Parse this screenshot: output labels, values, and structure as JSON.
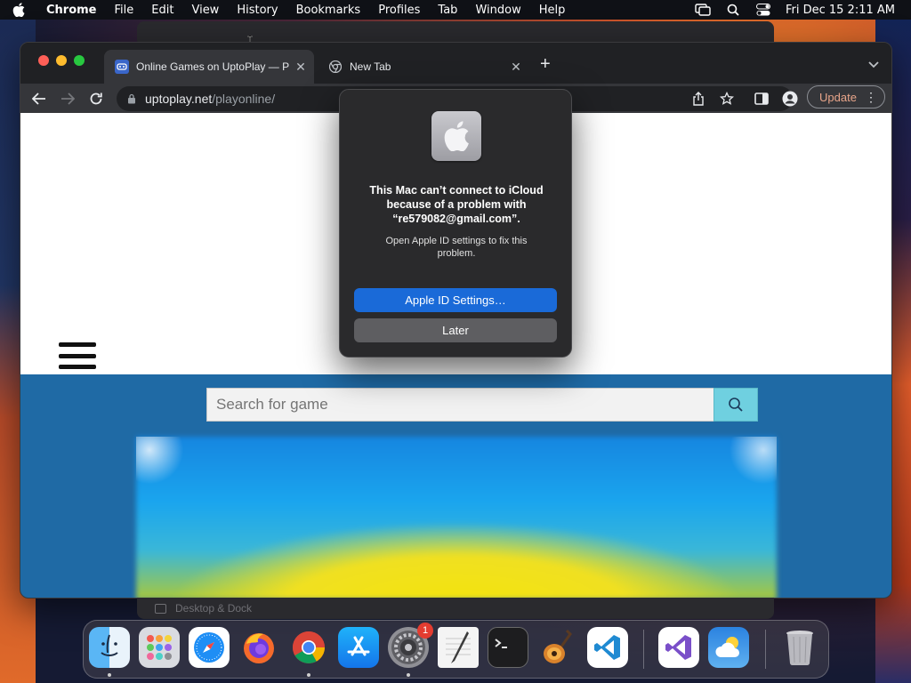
{
  "menubar": {
    "app_name": "Chrome",
    "items": [
      "File",
      "Edit",
      "View",
      "History",
      "Bookmarks",
      "Profiles",
      "Tab",
      "Window",
      "Help"
    ],
    "clock": "Fri Dec 15  2:11 AM"
  },
  "browser": {
    "tabs": [
      {
        "title": "Online Games on UptoPlay — P",
        "active": true
      },
      {
        "title": "New Tab",
        "active": false
      }
    ],
    "url_host": "uptoplay.net",
    "url_path": "/playonline/",
    "update_label": "Update"
  },
  "page": {
    "search_placeholder": "Search for game"
  },
  "dialog": {
    "title": "This Mac can’t connect to iCloud because of a problem with “re579082@gmail.com”.",
    "message": "Open Apple ID settings to fix this problem.",
    "primary_button": "Apple ID Settings…",
    "secondary_button": "Later"
  },
  "background": {
    "under_dock_label": "Desktop & Dock"
  },
  "dock": {
    "apps": [
      {
        "name": "finder-icon",
        "running": true
      },
      {
        "name": "launchpad-icon",
        "running": false
      },
      {
        "name": "safari-icon",
        "running": false
      },
      {
        "name": "firefox-icon",
        "running": false
      },
      {
        "name": "chrome-icon",
        "running": true
      },
      {
        "name": "app-store-icon",
        "running": false
      },
      {
        "name": "system-settings-icon",
        "running": true,
        "badge": "1"
      },
      {
        "name": "textedit-icon",
        "running": false
      },
      {
        "name": "terminal-icon",
        "running": false
      },
      {
        "name": "garageband-icon",
        "running": false
      },
      {
        "name": "vscode-icon",
        "running": false
      },
      {
        "name": "visual-studio-icon",
        "running": false
      },
      {
        "name": "weather-icon",
        "running": false
      },
      {
        "name": "trash-icon",
        "running": false
      }
    ]
  },
  "colors": {
    "dialog_primary": "#1a6ad8",
    "page_blue": "#1f6aa5",
    "search_button": "#6fd0e0"
  }
}
